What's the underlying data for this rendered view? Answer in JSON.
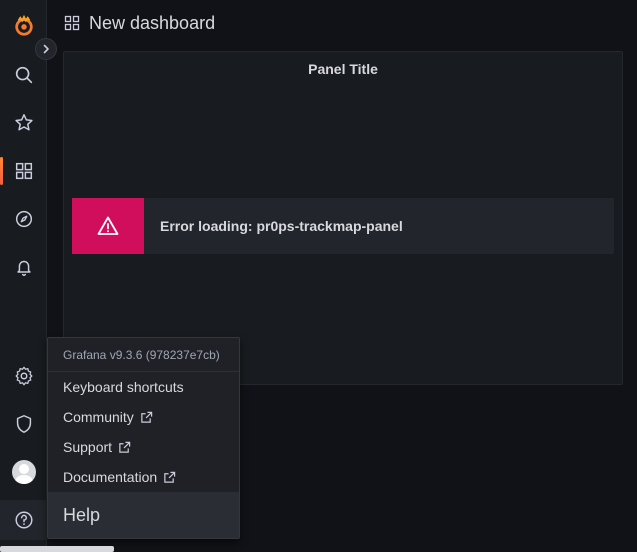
{
  "header": {
    "title": "New dashboard"
  },
  "panel": {
    "title": "Panel Title",
    "error_text": "Error loading: pr0ps-trackmap-panel"
  },
  "help_menu": {
    "version": "Grafana v9.3.6 (978237e7cb)",
    "items": [
      {
        "label": "Keyboard shortcuts",
        "external": false
      },
      {
        "label": "Community",
        "external": true
      },
      {
        "label": "Support",
        "external": true
      },
      {
        "label": "Documentation",
        "external": true
      }
    ],
    "footer": "Help"
  },
  "sidebar": {
    "items": [
      "grafana-logo",
      "search-icon",
      "star-icon",
      "dashboards-icon",
      "explore-icon",
      "alerting-icon",
      "settings-icon",
      "shield-icon",
      "avatar",
      "help-icon"
    ],
    "active": "dashboards-icon"
  },
  "colors": {
    "accent": "#f55f3e",
    "error": "#d10e5c",
    "background": "#111217",
    "panel": "#181b1f"
  }
}
